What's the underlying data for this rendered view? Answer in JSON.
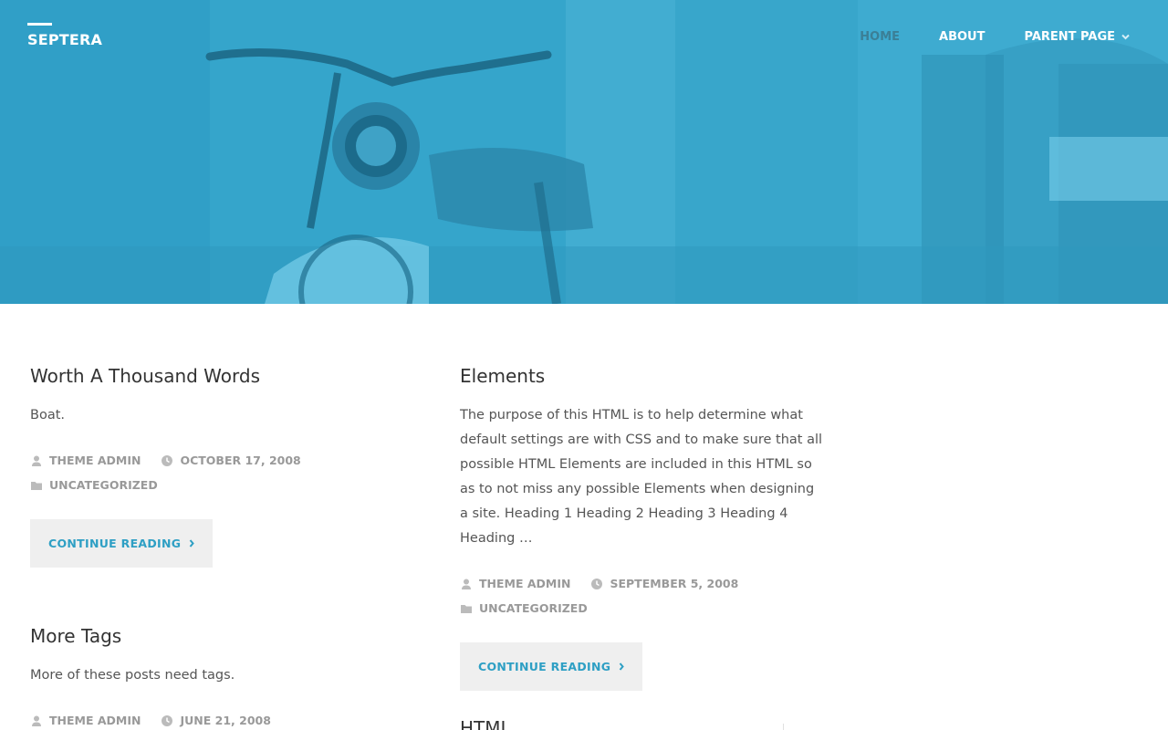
{
  "site": {
    "title": "SEPTERA"
  },
  "nav": {
    "items": [
      {
        "label": "HOME",
        "current": true,
        "has_submenu": false
      },
      {
        "label": "ABOUT",
        "current": false,
        "has_submenu": false
      },
      {
        "label": "PARENT PAGE",
        "current": false,
        "has_submenu": true
      }
    ]
  },
  "posts": [
    {
      "title": "Worth A Thousand Words",
      "excerpt": "Boat.",
      "author": "THEME ADMIN",
      "date": "OCTOBER 17, 2008",
      "category": "UNCATEGORIZED",
      "continue_label": "CONTINUE READING"
    },
    {
      "title": "More Tags",
      "excerpt": "More of these posts need tags.",
      "author": "THEME ADMIN",
      "date": "JUNE 21, 2008"
    },
    {
      "title": "Elements",
      "excerpt": "The purpose of this HTML is to help determine what default settings are with CSS and to make sure that all possible HTML Elements are included in this HTML so as to not miss any possible Elements when designing a site. Heading 1 Heading 2 Heading 3 Heading 4 Heading …",
      "author": "THEME ADMIN",
      "date": "SEPTEMBER 5, 2008",
      "category": "UNCATEGORIZED",
      "continue_label": "CONTINUE READING"
    },
    {
      "title": "HTML"
    }
  ],
  "icons": {
    "author": "user-icon",
    "date": "clock-icon",
    "category": "folder-icon",
    "continue": "chevron-right-icon",
    "submenu": "chevron-down-icon"
  },
  "colors": {
    "accent": "#2e9fc4",
    "hero_tint": "#3aa8cd",
    "nav_current": "#3b7f96",
    "meta": "#999999",
    "title": "#333333",
    "button_bg": "#efefef"
  }
}
